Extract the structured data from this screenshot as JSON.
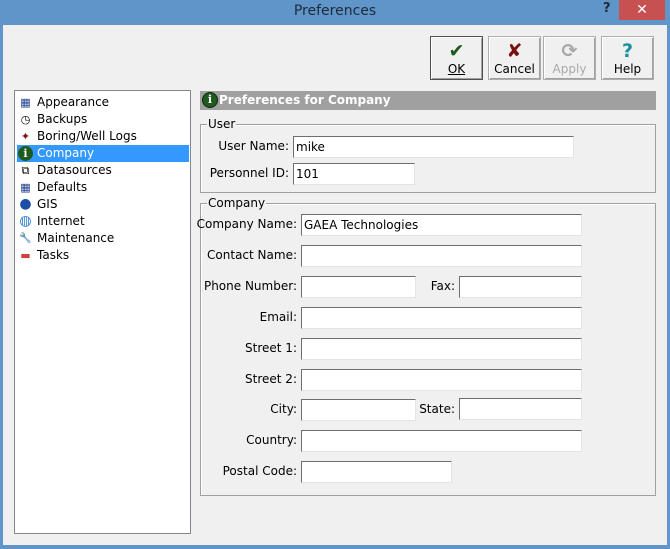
{
  "window": {
    "title": "Preferences",
    "help_glyph": "?",
    "close_glyph": "✕"
  },
  "toolbar": {
    "ok": {
      "label": "OK",
      "icon": "check-icon",
      "glyph": "✔",
      "color": "#1e5a1e"
    },
    "cancel": {
      "label": "Cancel",
      "icon": "x-icon",
      "glyph": "✘",
      "color": "#7a1010"
    },
    "apply": {
      "label": "Apply",
      "icon": "refresh-icon",
      "glyph": "⟳",
      "disabled": true
    },
    "help": {
      "label": "Help",
      "icon": "question-icon",
      "glyph": "?",
      "color": "#1a8fa0"
    }
  },
  "sidebar": {
    "selected": "Company",
    "items": [
      {
        "label": "Appearance",
        "icon": "window-icon",
        "glyph": "▦"
      },
      {
        "label": "Backups",
        "icon": "clock-icon",
        "glyph": "◷"
      },
      {
        "label": "Boring/Well Logs",
        "icon": "crosshair-icon",
        "glyph": "✦"
      },
      {
        "label": "Company",
        "icon": "info-icon",
        "glyph": "i"
      },
      {
        "label": "Datasources",
        "icon": "datasource-icon",
        "glyph": "⧉"
      },
      {
        "label": "Defaults",
        "icon": "window-icon",
        "glyph": "▦"
      },
      {
        "label": "GIS",
        "icon": "globe-icon",
        "glyph": "●"
      },
      {
        "label": "Internet",
        "icon": "globe-net-icon",
        "glyph": "◍"
      },
      {
        "label": "Maintenance",
        "icon": "wrench-icon",
        "glyph": "🔧"
      },
      {
        "label": "Tasks",
        "icon": "calendar-icon",
        "glyph": "▬"
      }
    ]
  },
  "panel": {
    "header": "Preferences for Company",
    "user": {
      "legend": "User",
      "user_name_label": "User Name:",
      "user_name": "mike",
      "personnel_id_label": "Personnel ID:",
      "personnel_id": "101"
    },
    "company": {
      "legend": "Company",
      "company_name_label": "Company Name:",
      "company_name": "GAEA Technologies",
      "contact_name_label": "Contact Name:",
      "contact_name": "",
      "phone_label": "Phone Number:",
      "phone": "",
      "fax_label": "Fax:",
      "fax": "",
      "email_label": "Email:",
      "email": "",
      "street1_label": "Street 1:",
      "street1": "",
      "street2_label": "Street 2:",
      "street2": "",
      "city_label": "City:",
      "city": "",
      "state_label": "State:",
      "state": "",
      "country_label": "Country:",
      "country": "",
      "postal_label": "Postal Code:",
      "postal": ""
    }
  }
}
